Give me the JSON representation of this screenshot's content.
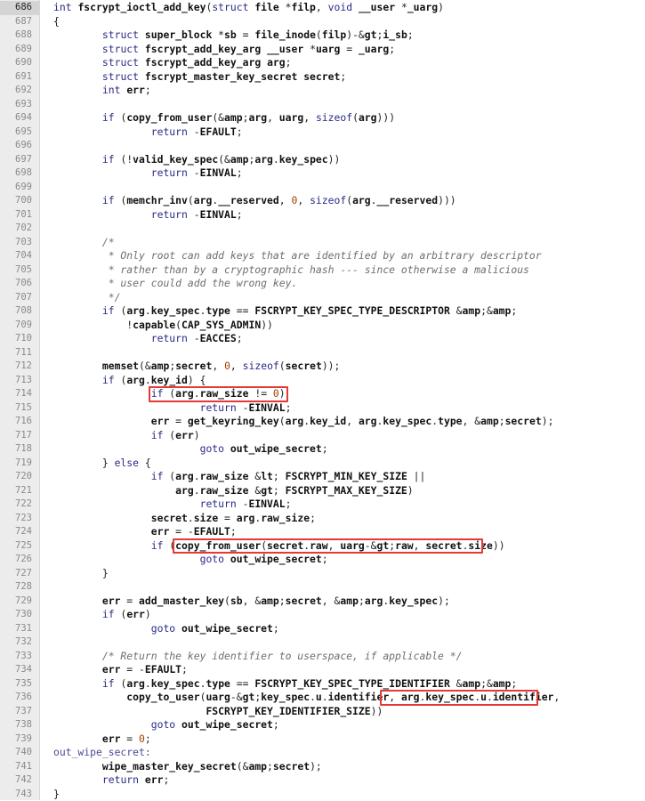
{
  "editor": {
    "current_line": "686",
    "lines": [
      {
        "n": "686",
        "t": "int fscrypt_ioctl_add_key(struct file *filp, void __user *_uarg)"
      },
      {
        "n": "687",
        "t": "{"
      },
      {
        "n": "688",
        "t": "        struct super_block *sb = file_inode(filp)->i_sb;"
      },
      {
        "n": "689",
        "t": "        struct fscrypt_add_key_arg __user *uarg = _uarg;"
      },
      {
        "n": "690",
        "t": "        struct fscrypt_add_key_arg arg;"
      },
      {
        "n": "691",
        "t": "        struct fscrypt_master_key_secret secret;"
      },
      {
        "n": "692",
        "t": "        int err;"
      },
      {
        "n": "693",
        "t": ""
      },
      {
        "n": "694",
        "t": "        if (copy_from_user(&arg, uarg, sizeof(arg)))"
      },
      {
        "n": "695",
        "t": "                return -EFAULT;"
      },
      {
        "n": "696",
        "t": ""
      },
      {
        "n": "697",
        "t": "        if (!valid_key_spec(&arg.key_spec))"
      },
      {
        "n": "698",
        "t": "                return -EINVAL;"
      },
      {
        "n": "699",
        "t": ""
      },
      {
        "n": "700",
        "t": "        if (memchr_inv(arg.__reserved, 0, sizeof(arg.__reserved)))"
      },
      {
        "n": "701",
        "t": "                return -EINVAL;"
      },
      {
        "n": "702",
        "t": ""
      },
      {
        "n": "703",
        "t": "        /*"
      },
      {
        "n": "704",
        "t": "         * Only root can add keys that are identified by an arbitrary descriptor"
      },
      {
        "n": "705",
        "t": "         * rather than by a cryptographic hash --- since otherwise a malicious"
      },
      {
        "n": "706",
        "t": "         * user could add the wrong key."
      },
      {
        "n": "707",
        "t": "         */"
      },
      {
        "n": "708",
        "t": "        if (arg.key_spec.type == FSCRYPT_KEY_SPEC_TYPE_DESCRIPTOR &&"
      },
      {
        "n": "709",
        "t": "            !capable(CAP_SYS_ADMIN))"
      },
      {
        "n": "710",
        "t": "                return -EACCES;"
      },
      {
        "n": "711",
        "t": ""
      },
      {
        "n": "712",
        "t": "        memset(&secret, 0, sizeof(secret));"
      },
      {
        "n": "713",
        "t": "        if (arg.key_id) {"
      },
      {
        "n": "714",
        "t": "                if (arg.raw_size != 0)"
      },
      {
        "n": "715",
        "t": "                        return -EINVAL;"
      },
      {
        "n": "716",
        "t": "                err = get_keyring_key(arg.key_id, arg.key_spec.type, &secret);"
      },
      {
        "n": "717",
        "t": "                if (err)"
      },
      {
        "n": "718",
        "t": "                        goto out_wipe_secret;"
      },
      {
        "n": "719",
        "t": "        } else {"
      },
      {
        "n": "720",
        "t": "                if (arg.raw_size < FSCRYPT_MIN_KEY_SIZE ||"
      },
      {
        "n": "721",
        "t": "                    arg.raw_size > FSCRYPT_MAX_KEY_SIZE)"
      },
      {
        "n": "722",
        "t": "                        return -EINVAL;"
      },
      {
        "n": "723",
        "t": "                secret.size = arg.raw_size;"
      },
      {
        "n": "724",
        "t": "                err = -EFAULT;"
      },
      {
        "n": "725",
        "t": "                if (copy_from_user(secret.raw, uarg->raw, secret.size))"
      },
      {
        "n": "726",
        "t": "                        goto out_wipe_secret;"
      },
      {
        "n": "727",
        "t": "        }"
      },
      {
        "n": "728",
        "t": ""
      },
      {
        "n": "729",
        "t": "        err = add_master_key(sb, &secret, &arg.key_spec);"
      },
      {
        "n": "730",
        "t": "        if (err)"
      },
      {
        "n": "731",
        "t": "                goto out_wipe_secret;"
      },
      {
        "n": "732",
        "t": ""
      },
      {
        "n": "733",
        "t": "        /* Return the key identifier to userspace, if applicable */"
      },
      {
        "n": "734",
        "t": "        err = -EFAULT;"
      },
      {
        "n": "735",
        "t": "        if (arg.key_spec.type == FSCRYPT_KEY_SPEC_TYPE_IDENTIFIER &&"
      },
      {
        "n": "736",
        "t": "            copy_to_user(uarg->key_spec.u.identifier, arg.key_spec.u.identifier,"
      },
      {
        "n": "737",
        "t": "                         FSCRYPT_KEY_IDENTIFIER_SIZE))"
      },
      {
        "n": "738",
        "t": "                goto out_wipe_secret;"
      },
      {
        "n": "739",
        "t": "        err = 0;"
      },
      {
        "n": "740",
        "t": "out_wipe_secret:"
      },
      {
        "n": "741",
        "t": "        wipe_master_key_secret(&secret);"
      },
      {
        "n": "742",
        "t": "        return err;"
      },
      {
        "n": "743",
        "t": "}"
      }
    ],
    "highlights": [
      {
        "line": "714",
        "text": "if (arg.raw_size != 0)"
      },
      {
        "line": "725",
        "text": "copy_from_user(secret.raw, uarg->raw, secret.size)"
      },
      {
        "line": "736",
        "text": "arg.key_spec.u.identifier"
      }
    ],
    "colors": {
      "highlight_border": "#e53935",
      "gutter_bg": "#ececec",
      "current_line_bg": "#d4d4d4",
      "keyword": "#2a2a8a",
      "comment": "#6e6e6e"
    }
  }
}
